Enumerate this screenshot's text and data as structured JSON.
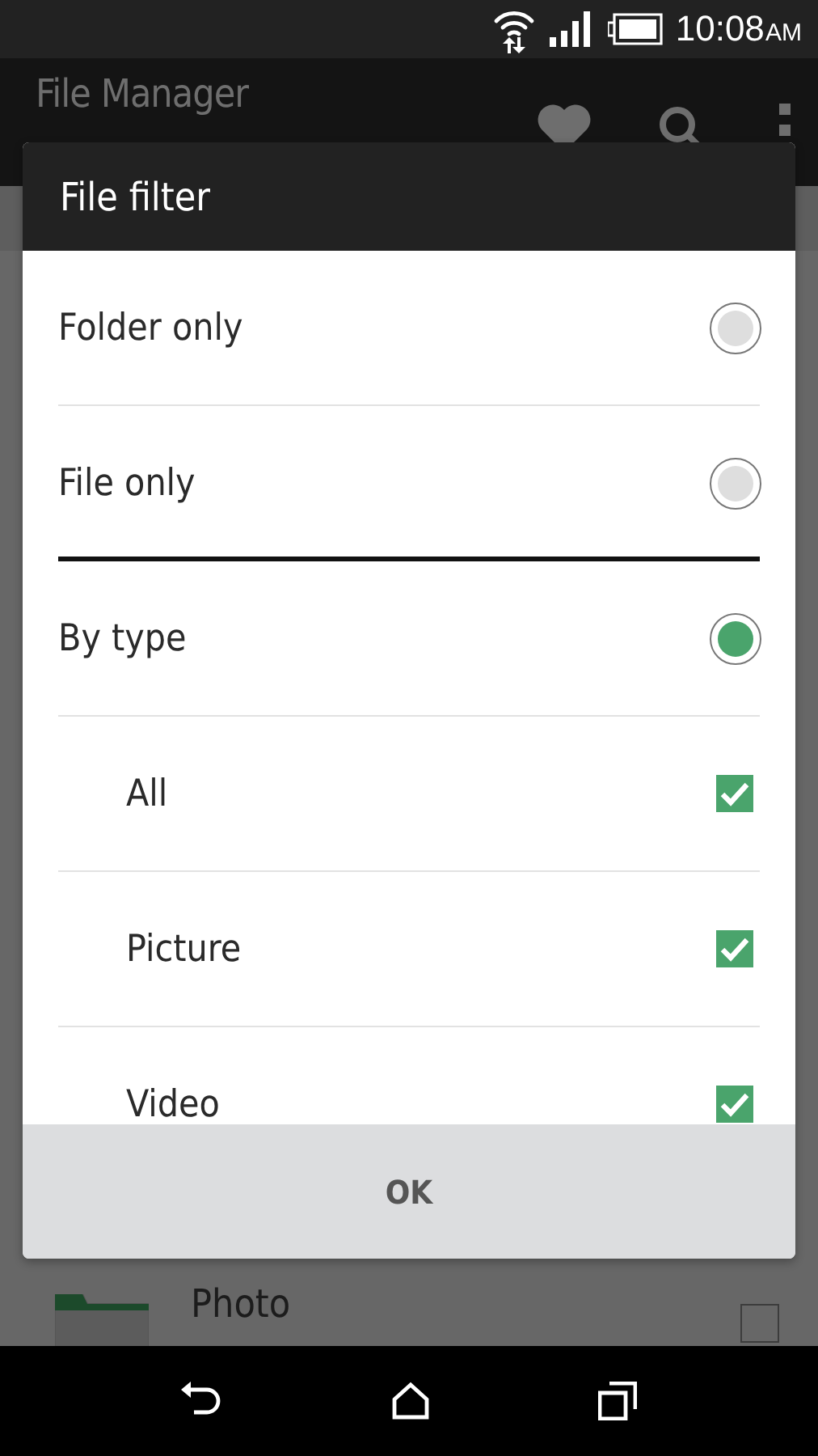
{
  "status_bar": {
    "time": "10:08",
    "meridiem": "AM"
  },
  "app_bar": {
    "title": "File Manager"
  },
  "background_list": [
    {
      "name": "Photo",
      "checked": false
    }
  ],
  "dialog": {
    "title": "File filter",
    "button": "OK",
    "items": [
      {
        "kind": "radio",
        "label": "Folder only",
        "selected": false
      },
      {
        "kind": "radio",
        "label": "File only",
        "selected": false
      },
      {
        "kind": "rule"
      },
      {
        "kind": "radio",
        "label": "By type",
        "selected": true
      },
      {
        "kind": "checkbox",
        "label": "All",
        "checked": true
      },
      {
        "kind": "checkbox",
        "label": "Picture",
        "checked": true
      },
      {
        "kind": "checkbox",
        "label": "Video",
        "checked": true
      }
    ]
  }
}
